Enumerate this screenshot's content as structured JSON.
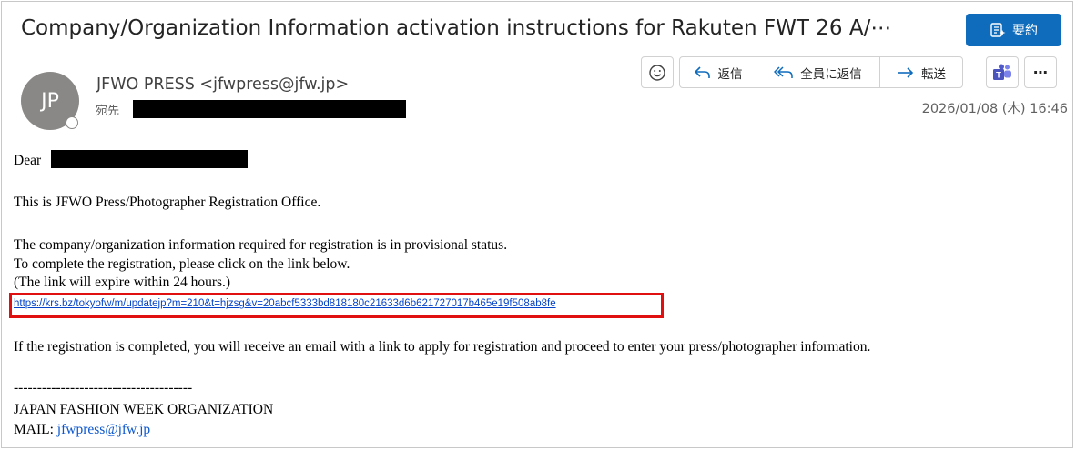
{
  "header": {
    "subject": "Company/Organization Information activation instructions for Rakuten FWT 26 A/⋯",
    "summary_label": "要約"
  },
  "sender": {
    "initials": "JP",
    "display": "JFWO PRESS <jfwpress@jfw.jp>",
    "to_label": "宛先",
    "date": "2026/01/08 (木) 16:46"
  },
  "actions": {
    "reply": "返信",
    "reply_all": "全員に返信",
    "forward": "転送",
    "more": "⋯"
  },
  "body": {
    "greeting": "Dear",
    "line1": "This is JFWO Press/Photographer Registration Office.",
    "line2": "The company/organization information required for registration is in provisional status.",
    "line3": "To complete the registration, please click on the link below.",
    "line4": "(The link will expire within 24 hours.)",
    "url": "https://krs.bz/tokyofw/m/updatejp?m=210&t=hjzsg&v=20abcf5333bd818180c21633d6b621727017b465e19f508ab8fe",
    "line5": "If the registration is completed, you will receive an email with a link to apply for registration and proceed to enter your press/photographer information.",
    "separator": "--------------------------------------",
    "org": "JAPAN FASHION WEEK ORGANIZATION",
    "mail_label": "MAIL: ",
    "mail_address": "jfwpress@jfw.jp"
  },
  "colors": {
    "accent": "#0f6cbd",
    "highlight_box": "#e01010",
    "link": "#0645c8"
  },
  "icons": [
    "summary-icon",
    "emoji-icon",
    "reply-icon",
    "reply-all-icon",
    "forward-icon",
    "teams-icon",
    "more-icon"
  ]
}
